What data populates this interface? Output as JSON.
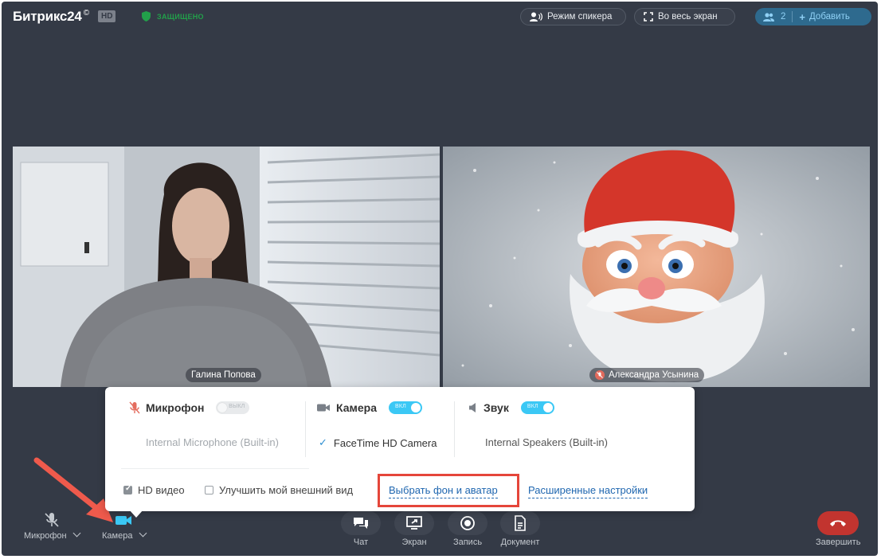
{
  "header": {
    "logo": "Битрикс24",
    "logo_mark": "©",
    "hd_badge": "HD",
    "secure_label": "ЗАЩИЩЕНО",
    "speaker_mode": "Режим спикера",
    "fullscreen": "Во весь экран",
    "participants_count": "2",
    "add_label": "Добавить"
  },
  "videos": {
    "left_name": "Галина Попова",
    "right_name": "Александра Усынина"
  },
  "panel": {
    "mic": {
      "title": "Микрофон",
      "toggle": "ВЫКЛ",
      "device": "Internal Microphone (Built-in)"
    },
    "camera": {
      "title": "Камера",
      "toggle": "ВКЛ",
      "device": "FaceTime HD Camera"
    },
    "sound": {
      "title": "Звук",
      "toggle": "ВКЛ",
      "device": "Internal Speakers (Built-in)"
    },
    "hd_video": "HD видео",
    "improve_look": "Улучшить мой внешний вид",
    "choose_bg": "Выбрать фон и аватар",
    "advanced": "Расширенные настройки"
  },
  "toolbar": {
    "mic": "Микрофон",
    "camera": "Камера",
    "chat": "Чат",
    "screen": "Экран",
    "record": "Запись",
    "document": "Документ",
    "end": "Завершить"
  },
  "colors": {
    "background": "#343a46",
    "accent": "#3bc8f5",
    "link": "#2067b0",
    "highlight": "#e5463a",
    "end_call": "#c2342f",
    "secure": "#22a04a"
  }
}
